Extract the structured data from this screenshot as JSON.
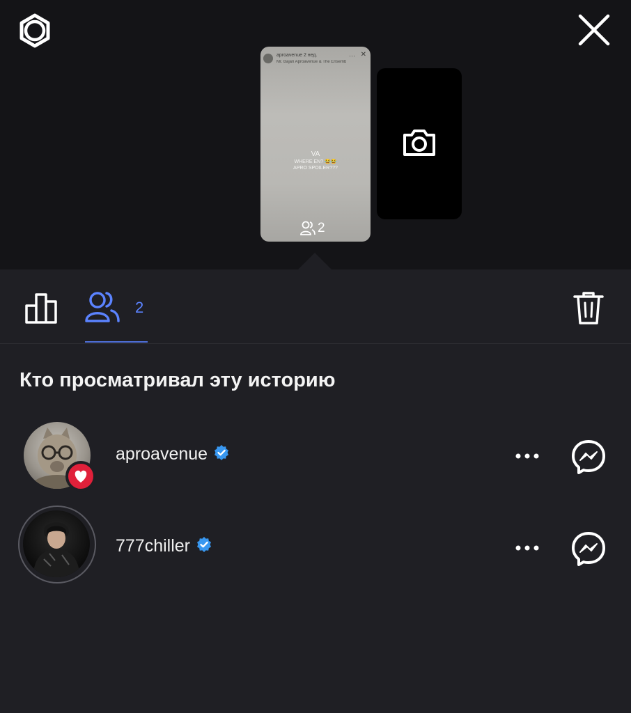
{
  "header": {
    "settings_icon": "gear-icon",
    "close_icon": "close-icon"
  },
  "story_preview": {
    "account": "aproavenue",
    "time": "2 нед.",
    "song": "Mr. Bajan  Aproavenue & The Ensemble Of It...",
    "overlay_title": "VA",
    "overlay_line1": "WHERE EN? 😂😂",
    "overlay_line2": "APRO SPOILER???",
    "viewer_count": "2"
  },
  "tabs": {
    "stats_icon": "bar-chart-icon",
    "viewers_icon": "viewers-icon",
    "viewers_count": "2",
    "delete_icon": "trash-icon"
  },
  "section_title": "Кто просматривал эту историю",
  "viewers": [
    {
      "username": "aproavenue",
      "verified": true,
      "liked": true
    },
    {
      "username": "777chiller",
      "verified": true,
      "liked": false
    }
  ],
  "more_label": "•••",
  "colors": {
    "accent": "#5b83ff",
    "background": "#1f1f24",
    "top_background": "#141417",
    "verified": "#3897f0",
    "like": "#e0203a"
  }
}
